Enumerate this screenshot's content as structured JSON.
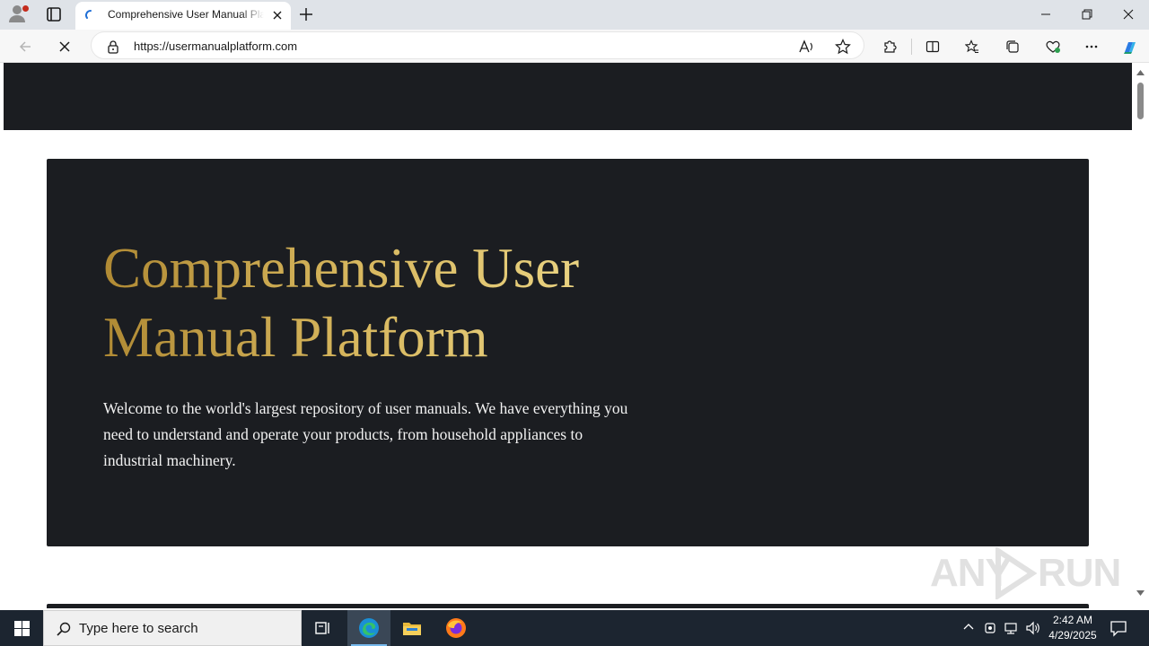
{
  "browser": {
    "tab": {
      "title": "Comprehensive User Manual Platform"
    },
    "address_bar": {
      "url": "https://usermanualplatform.com"
    }
  },
  "page": {
    "hero": {
      "title": "Comprehensive User Manual Platform",
      "description": "Welcome to the world's largest repository of user manuals. We have everything you need to understand and operate your products, from household appliances to industrial machinery."
    },
    "watermark": {
      "text_left": "ANY",
      "text_right": "RUN"
    }
  },
  "taskbar": {
    "search_placeholder": "Type here to search",
    "clock": {
      "time": "2:42 AM",
      "date": "4/29/2025"
    }
  },
  "colors": {
    "hero_background": "#1b1d21",
    "hero_title_gold": "#d7b75e",
    "taskbar": "#1c2530"
  }
}
